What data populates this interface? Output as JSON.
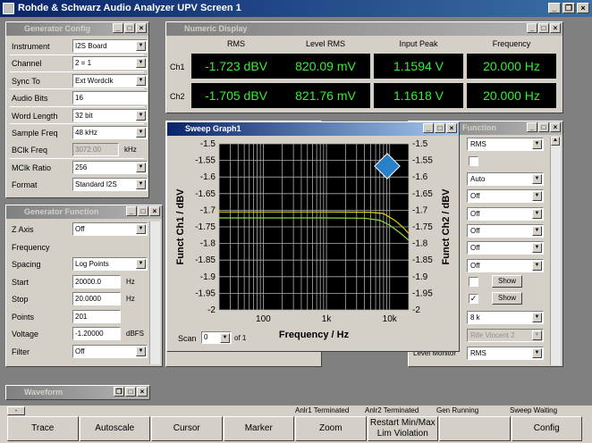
{
  "app": {
    "title": "Rohde & Schwarz Audio Analyzer UPV Screen 1"
  },
  "generator_config": {
    "title": "Generator Config",
    "rows": [
      {
        "label": "Instrument",
        "value": "I2S Board",
        "type": "select"
      },
      {
        "label": "Channel",
        "value": "2 = 1",
        "type": "select"
      },
      {
        "label": "Sync To",
        "value": "Ext Wordclk",
        "type": "select"
      },
      {
        "label": "Audio Bits",
        "value": "16",
        "type": "input"
      },
      {
        "label": "Word Length",
        "value": "32 bit",
        "type": "select"
      },
      {
        "label": "Sample Freq",
        "value": "48 kHz",
        "type": "select"
      },
      {
        "label": "BClk Freq",
        "value": "3072.00",
        "unit": "kHz",
        "type": "readonly"
      },
      {
        "label": "MClk Ratio",
        "value": "256",
        "type": "select"
      },
      {
        "label": "Format",
        "value": "Standard I2S",
        "type": "select"
      }
    ]
  },
  "generator_function": {
    "title": "Generator Function",
    "rows": [
      {
        "label": "Z Axis",
        "value": "Off",
        "type": "select"
      },
      {
        "label": "Frequency",
        "value": "",
        "type": "heading"
      },
      {
        "label": "Spacing",
        "value": "Log Points",
        "type": "select"
      },
      {
        "label": "Start",
        "value": "20000.0",
        "unit": "Hz",
        "type": "input"
      },
      {
        "label": "Stop",
        "value": "20.0000",
        "unit": "Hz",
        "type": "input"
      },
      {
        "label": "Points",
        "value": "201",
        "type": "input"
      },
      {
        "label": "Voltage",
        "value": "-1.20000",
        "unit": "dBFS",
        "type": "input"
      },
      {
        "label": "Filter",
        "value": "Off",
        "type": "select"
      }
    ]
  },
  "numeric_display": {
    "title": "Numeric Display",
    "headers": [
      "RMS",
      "Level RMS",
      "Input Peak",
      "Frequency"
    ],
    "rows": [
      {
        "ch": "Ch1",
        "values": [
          "-1.723 dBV",
          "820.09 mV",
          "1.1594 V",
          "20.000 Hz"
        ]
      },
      {
        "ch": "Ch2",
        "values": [
          "-1.705 dBV",
          "821.76 mV",
          "1.1618 V",
          "20.000 Hz"
        ]
      }
    ]
  },
  "analyzer_function": {
    "title": "Function",
    "values": [
      "RMS",
      "",
      "Auto",
      "Off",
      "Off",
      "Off",
      "Off",
      "Off"
    ],
    "show_label": "Show",
    "select_8k": "8 k",
    "filter_disabled": "Rife Vincent 2",
    "level_monitor_label": "Level Monitor",
    "level_monitor_value": "RMS"
  },
  "sweep_graph": {
    "title": "Sweep Graph1",
    "scan_label": "Scan",
    "scan_value": "0",
    "scan_of": "of 1"
  },
  "chart_data": {
    "type": "line",
    "title": "",
    "xlabel": "Frequency / Hz",
    "ylabel": "Funct Ch1 / dBV",
    "ylabel_right": "Funct Ch2 / dBV",
    "x_scale": "log",
    "xlim": [
      20,
      20000
    ],
    "ylim": [
      -2,
      -1.5
    ],
    "grid": true,
    "x_ticks": [
      "100",
      "1k",
      "10k"
    ],
    "y_ticks": [
      "-1.5",
      "-1.55",
      "-1.6",
      "-1.65",
      "-1.7",
      "-1.75",
      "-1.8",
      "-1.85",
      "-1.9",
      "-1.95",
      "-2"
    ],
    "series": [
      {
        "color": "#d8d800",
        "x": [
          20,
          100,
          1000,
          5000,
          8000,
          12000,
          16000,
          20000
        ],
        "y": [
          -1.705,
          -1.705,
          -1.705,
          -1.706,
          -1.71,
          -1.73,
          -1.75,
          -1.77
        ]
      },
      {
        "color": "#88dd44",
        "x": [
          20,
          100,
          1000,
          4000,
          7000,
          10000,
          15000,
          20000
        ],
        "y": [
          -1.723,
          -1.723,
          -1.723,
          -1.724,
          -1.73,
          -1.745,
          -1.77,
          -1.79
        ]
      }
    ]
  },
  "waveform": {
    "title": "Waveform"
  },
  "status": {
    "items": [
      "Anlr1 Terminated",
      "Anlr2 Terminated",
      "Gen Running",
      "Sweep Waiting"
    ],
    "dash": "-"
  },
  "softkeys": [
    "Trace",
    "Autoscale",
    "Cursor",
    "Marker",
    "Zoom",
    "Restart Min/Max Lim Violation",
    "",
    "Config"
  ]
}
